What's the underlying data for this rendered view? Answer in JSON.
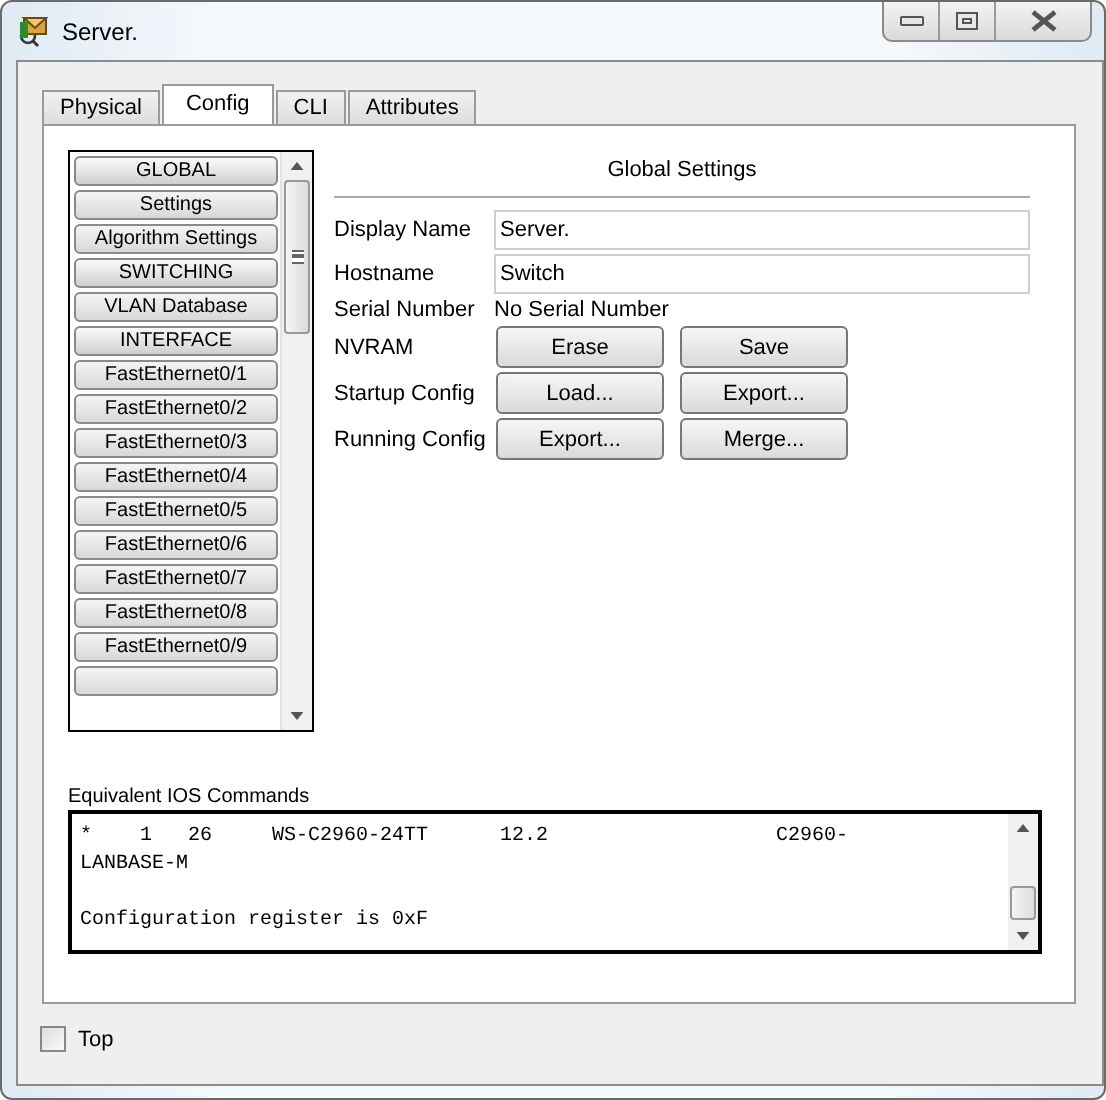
{
  "window": {
    "title": "Server."
  },
  "tabs": [
    {
      "label": "Physical",
      "selected": false
    },
    {
      "label": "Config",
      "selected": true
    },
    {
      "label": "CLI",
      "selected": false
    },
    {
      "label": "Attributes",
      "selected": false
    }
  ],
  "sidebar": {
    "items": [
      {
        "label": "GLOBAL",
        "kind": "heading"
      },
      {
        "label": "Settings",
        "kind": "item"
      },
      {
        "label": "Algorithm Settings",
        "kind": "item"
      },
      {
        "label": "SWITCHING",
        "kind": "heading"
      },
      {
        "label": "VLAN Database",
        "kind": "item"
      },
      {
        "label": "INTERFACE",
        "kind": "heading"
      },
      {
        "label": "FastEthernet0/1",
        "kind": "item"
      },
      {
        "label": "FastEthernet0/2",
        "kind": "item"
      },
      {
        "label": "FastEthernet0/3",
        "kind": "item"
      },
      {
        "label": "FastEthernet0/4",
        "kind": "item"
      },
      {
        "label": "FastEthernet0/5",
        "kind": "item"
      },
      {
        "label": "FastEthernet0/6",
        "kind": "item"
      },
      {
        "label": "FastEthernet0/7",
        "kind": "item"
      },
      {
        "label": "FastEthernet0/8",
        "kind": "item"
      },
      {
        "label": "FastEthernet0/9",
        "kind": "item"
      }
    ]
  },
  "settings": {
    "title": "Global Settings",
    "fields": [
      {
        "label": "Display Name",
        "kind": "input",
        "value": "Server."
      },
      {
        "label": "Hostname",
        "kind": "input",
        "value": "Switch"
      },
      {
        "label": "Serial Number",
        "kind": "text",
        "value": "No Serial Number"
      },
      {
        "label": "NVRAM",
        "kind": "buttons",
        "buttons": [
          "Erase",
          "Save"
        ]
      },
      {
        "label": "Startup Config",
        "kind": "buttons",
        "buttons": [
          "Load...",
          "Export..."
        ]
      },
      {
        "label": "Running Config",
        "kind": "buttons",
        "buttons": [
          "Export...",
          "Merge..."
        ]
      }
    ]
  },
  "ios_commands": {
    "label": "Equivalent IOS Commands",
    "paragraphs": [
      [
        "*    1   26     WS-C2960-24TT      12.2                   C2960-",
        "LANBASE-M"
      ],
      [
        "Configuration register is 0xF"
      ]
    ]
  },
  "top_checkbox": {
    "label": "Top",
    "checked": false
  }
}
